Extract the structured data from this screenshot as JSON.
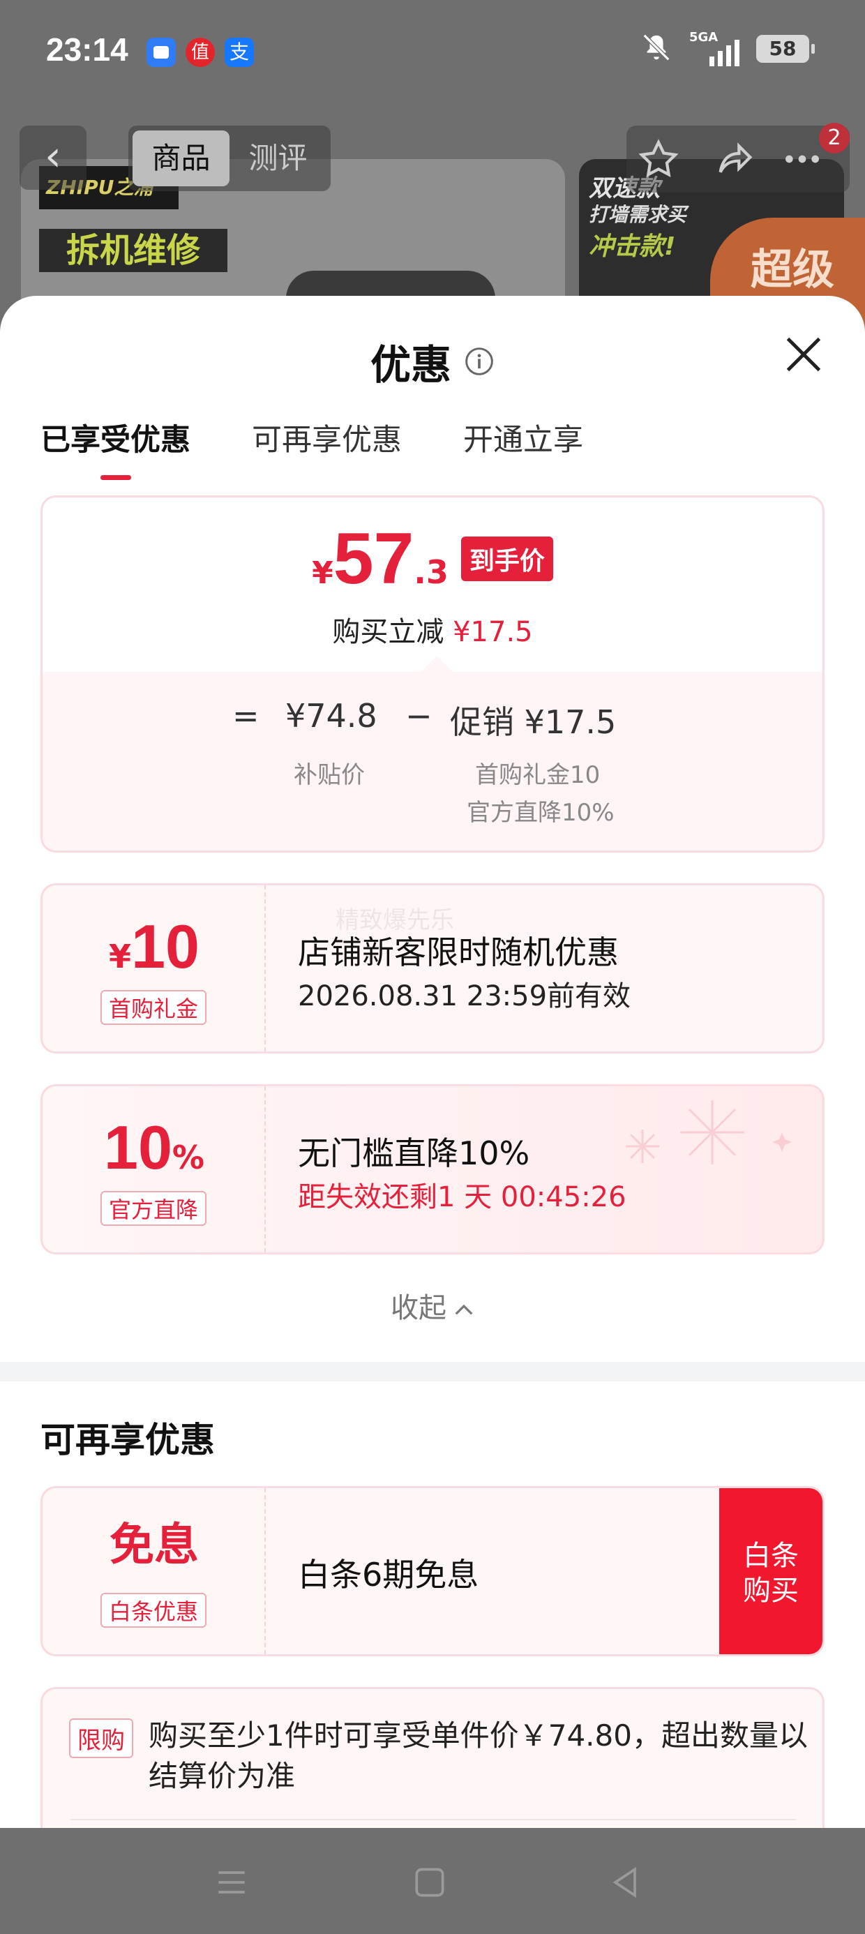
{
  "status_bar": {
    "time": "23:14",
    "network_label": "5GA",
    "battery": "58"
  },
  "background": {
    "segment_tabs": [
      "商品",
      "测评"
    ],
    "brand_text": "ZHIPU之浦",
    "banner_text": "拆机维修",
    "side_text_1": "双速款",
    "side_text_2": "打墙需求买",
    "side_text_3": "冲击款!",
    "super_tag": "超级",
    "notification_count": "2"
  },
  "sheet": {
    "title": "优惠",
    "tabs": [
      "已享受优惠",
      "可再享优惠",
      "开通立享"
    ],
    "summary": {
      "currency": "¥",
      "price_int": "57",
      "price_dec": ".3",
      "price_tag": "到手价",
      "reduce_label": "购买立减",
      "reduce_value": "¥17.5",
      "eq": "=",
      "base_value": "¥74.8",
      "base_label": "补贴价",
      "minus": "−",
      "promo_value": "促销 ¥17.5",
      "promo_line1": "首购礼金10",
      "promo_line2": "官方直降10%"
    },
    "coupon1": {
      "currency": "¥",
      "value": "10",
      "tag": "首购礼金",
      "title": "店铺新客限时随机优惠",
      "subtitle": "2026.08.31 23:59前有效",
      "watermark": "精致爆先乐"
    },
    "coupon2": {
      "value": "10",
      "unit": "%",
      "tag": "官方直降",
      "title": "无门槛直降10%",
      "countdown": "距失效还剩1 天 00:45:26"
    },
    "collapse_label": "收起",
    "more_title": "可再享优惠",
    "coupon3": {
      "value": "免息",
      "tag": "白条优惠",
      "title": "白条6期免息",
      "button_line1": "白条",
      "button_line2": "购买"
    },
    "limit": {
      "tag": "限购",
      "text": "购买至少1件时可享受单件价￥74.80，超出数量以结算价为准"
    }
  },
  "colors": {
    "accent": "#e4203b",
    "coupon_bg": "#fff6f6",
    "border": "#fadbe0"
  }
}
